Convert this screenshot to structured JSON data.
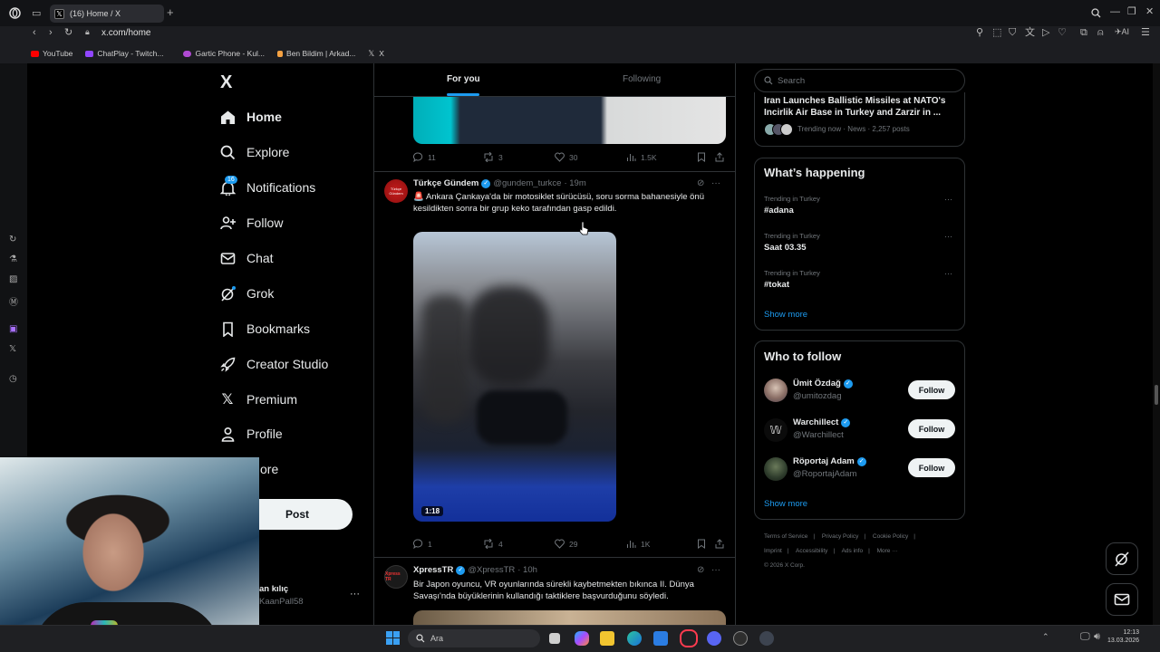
{
  "browser": {
    "tab_title": "(16) Home / X",
    "url": "x.com/home",
    "bookmarks": [
      "YouTube",
      "ChatPlay - Twitch...",
      "Gartic Phone - Kul...",
      "Ben Bildim | Arkad...",
      "X"
    ],
    "ai_label": "AI"
  },
  "nav": {
    "logo": "X",
    "items": [
      {
        "label": "Home",
        "icon": "home-icon"
      },
      {
        "label": "Explore",
        "icon": "search-icon"
      },
      {
        "label": "Notifications",
        "icon": "bell-icon",
        "badge": "16"
      },
      {
        "label": "Follow",
        "icon": "add-person-icon"
      },
      {
        "label": "Chat",
        "icon": "mail-icon"
      },
      {
        "label": "Grok",
        "icon": "grok-icon"
      },
      {
        "label": "Bookmarks",
        "icon": "bookmark-icon"
      },
      {
        "label": "Creator Studio",
        "icon": "rocket-icon"
      },
      {
        "label": "Premium",
        "icon": "x-icon"
      },
      {
        "label": "Profile",
        "icon": "person-icon"
      },
      {
        "label": "ore",
        "icon": "more-icon"
      }
    ],
    "post_label": "Post",
    "account_name": "an kılıç",
    "account_handle": "KaanPall58",
    "account_more": "···"
  },
  "feed": {
    "tabs": [
      "For you",
      "Following"
    ],
    "prev_actions": {
      "replies": "11",
      "reposts": "3",
      "likes": "30",
      "views": "1.5K"
    },
    "tweet1": {
      "name": "Türkçe Gündem",
      "handle": "@gundem_turkce",
      "time": "· 19m",
      "text": "🚨 Ankara Çankaya'da bir motosiklet sürücüsü, soru sorma bahanesiyle önü kesildikten sonra bir grup keko tarafından gasp edildi.",
      "avatar_text": "Türkçe Gündem",
      "duration": "1:18",
      "actions": {
        "replies": "1",
        "reposts": "4",
        "likes": "29",
        "views": "1K"
      }
    },
    "tweet2": {
      "name": "XpressTR",
      "handle": "@XpressTR",
      "time": "· 10h",
      "avatar_text": "Xpress TR",
      "text": "Bir Japon oyuncu, VR oyunlarında sürekli kaybetmekten bıkınca II. Dünya Savaşı'nda büyüklerinin kullandığı taktiklere başvurduğunu söyledi."
    },
    "more_icon": "···"
  },
  "sidebar": {
    "search_placeholder": "Search",
    "news": {
      "title": "Iran Launches Ballistic Missiles at NATO's Incirlik Air Base in Turkey and Zarzir in ...",
      "meta": "Trending now · News · 2,257 posts"
    },
    "happening": {
      "title": "What’s happening",
      "trends": [
        {
          "context": "Trending in Turkey",
          "name": "#adana"
        },
        {
          "context": "Trending in Turkey",
          "name": "Saat 03.35"
        },
        {
          "context": "Trending in Turkey",
          "name": "#tokat"
        }
      ],
      "show_more": "Show more"
    },
    "who_to_follow": {
      "title": "Who to follow",
      "accounts": [
        {
          "name": "Ümit Özdağ",
          "handle": "@umitozdag",
          "button": "Follow"
        },
        {
          "name": "Warchillect",
          "handle": "@Warchillect",
          "button": "Follow"
        },
        {
          "name": "Röportaj Adam",
          "handle": "@RoportajAdam",
          "button": "Follow"
        }
      ],
      "show_more": "Show more"
    },
    "footer": {
      "row1": [
        "Terms of Service",
        "|",
        "Privacy Policy",
        "|",
        "Cookie Policy",
        "|"
      ],
      "row2": [
        "Imprint",
        "|",
        "Accessibility",
        "|",
        "Ads info",
        "|",
        "More ···"
      ],
      "copyright": "© 2026 X Corp."
    }
  },
  "taskbar": {
    "search_label": "Ara",
    "time": "12:13",
    "date": "13.03.2026"
  },
  "colors": {
    "accent": "#1d9bf0",
    "background": "#000000",
    "border": "#2f3336",
    "muted": "#71767b"
  }
}
